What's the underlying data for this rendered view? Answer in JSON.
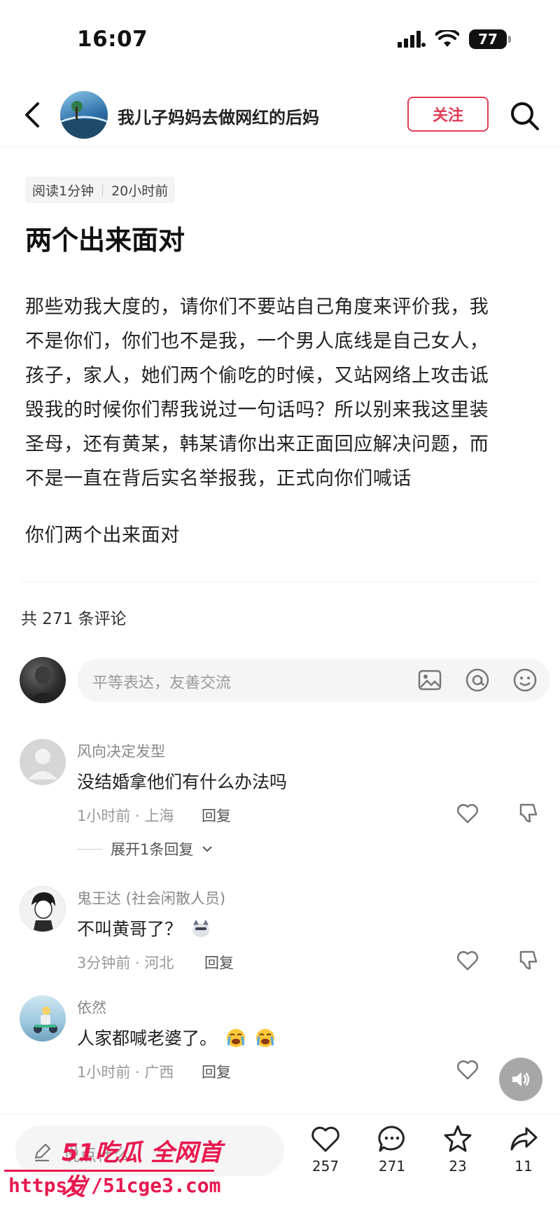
{
  "status_bar": {
    "time": "16:07",
    "battery": "77"
  },
  "header": {
    "author": "我儿子妈妈去做网红的后妈",
    "follow_label": "关注"
  },
  "article": {
    "read_time": "阅读1分钟",
    "posted": "20小时前",
    "title": "两个出来面对",
    "body_lines": [
      "那些劝我大度的，请你们不要站自己角度来评价我，我",
      "不是你们，你们也不是我，一个男人底线是自己女人，",
      "孩子，家人，她们两个偷吃的时候，又站网络上攻击诋",
      "毁我的时候你们帮我说过一句话吗？所以别来我这里装",
      "圣母，还有黄某，韩某请你出来正面回应解决问题，而",
      "不是一直在背后实名举报我，正式向你们喊话"
    ],
    "closing": "你们两个出来面对"
  },
  "comments_section": {
    "count_label": "共 271 条评论",
    "input_placeholder": "平等表达，友善交流"
  },
  "comments": [
    {
      "name": "风向决定发型",
      "text": "没结婚拿他们有什么办法吗",
      "meta": "1小时前 · 上海",
      "reply_label": "回复",
      "expand_label": "展开1条回复"
    },
    {
      "name": "鬼王达 (社会闲散人员)",
      "text": "不叫黄哥了？",
      "meta": "3分钟前 · 河北",
      "reply_label": "回复"
    },
    {
      "name": "依然",
      "text": "人家都喊老婆了。",
      "meta": "1小时前 · 广西",
      "reply_label": "回复"
    }
  ],
  "bottom_bar": {
    "input_placeholder": "说点什么",
    "likes": "257",
    "comments": "271",
    "favorites": "23",
    "shares": "11"
  },
  "watermark": {
    "brand": "51吃瓜 全网首发",
    "url": "https://51cge3.com"
  },
  "colors": {
    "accent": "#e23b57",
    "watermark": "#e8184f"
  },
  "icons": [
    "back-icon",
    "search-icon",
    "image-icon",
    "at-icon",
    "emoji-icon",
    "heart-icon",
    "dislike-icon",
    "comment-icon",
    "star-icon",
    "share-icon",
    "speaker-icon",
    "pencil-icon"
  ]
}
